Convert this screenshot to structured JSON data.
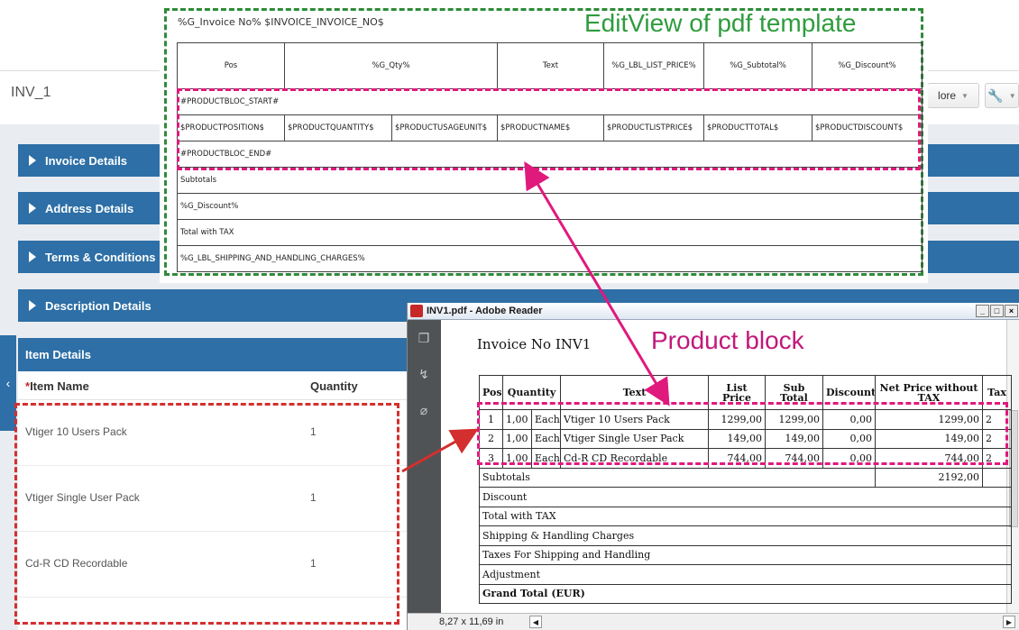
{
  "crm": {
    "record_title": "INV_1",
    "more_label": "lore",
    "blocks": [
      {
        "label": "Invoice Details"
      },
      {
        "label": "Address Details"
      },
      {
        "label": "Terms & Conditions"
      },
      {
        "label": "Description Details"
      }
    ],
    "item_details": {
      "title": "Item Details",
      "required_mark": "*",
      "col_name": "Item Name",
      "col_qty": "Quantity",
      "rows": [
        {
          "name": "Vtiger 10 Users Pack",
          "qty": "1"
        },
        {
          "name": "Vtiger Single User Pack",
          "qty": "1"
        },
        {
          "name": "Cd-R CD Recordable",
          "qty": "1"
        }
      ]
    }
  },
  "edit_view": {
    "header": "%G_Invoice No% $INVOICE_INVOICE_NO$",
    "title": "EditView of pdf template",
    "columns": [
      "Pos",
      "%G_Qty%",
      "Text",
      "%G_LBL_LIST_PRICE%",
      "%G_Subtotal%",
      "%G_Discount%"
    ],
    "block_start": "#PRODUCTBLOC_START#",
    "vars": [
      "$PRODUCTPOSITION$",
      "$PRODUCTQUANTITY$",
      "$PRODUCTUSAGEUNIT$",
      "$PRODUCTNAME$",
      "$PRODUCTLISTPRICE$",
      "$PRODUCTTOTAL$",
      "$PRODUCTDISCOUNT$"
    ],
    "block_end": "#PRODUCTBLOC_END#",
    "totals": [
      "Subtotals",
      "%G_Discount%",
      "Total with TAX",
      "%G_LBL_SHIPPING_AND_HANDLING_CHARGES%"
    ]
  },
  "reader": {
    "title": "INV1.pdf - Adobe Reader",
    "heading": "Invoice No INV1",
    "product_block_label": "Product block",
    "columns": [
      "Pos",
      "Quantity",
      "Text",
      "List Price",
      "Sub Total",
      "Discount",
      "Net Price without TAX",
      "Tax"
    ],
    "rows": [
      {
        "pos": "1",
        "qty": "1,00",
        "unit": "Each",
        "text": "Vtiger 10 Users Pack",
        "list": "1299,00",
        "sub": "1299,00",
        "disc": "0,00",
        "net": "1299,00",
        "tax": "2"
      },
      {
        "pos": "2",
        "qty": "1,00",
        "unit": "Each",
        "text": "Vtiger Single User Pack",
        "list": "149,00",
        "sub": "149,00",
        "disc": "0,00",
        "net": "149,00",
        "tax": "2"
      },
      {
        "pos": "3",
        "qty": "1,00",
        "unit": "Each",
        "text": "Cd-R CD Recordable",
        "list": "744,00",
        "sub": "744,00",
        "disc": "0,00",
        "net": "744,00",
        "tax": "2"
      }
    ],
    "subtotals_label": "Subtotals",
    "subtotals_value": "2192,00",
    "summary": [
      "Discount",
      "Total with TAX",
      "Shipping & Handling Charges",
      "Taxes For Shipping and Handling",
      "Adjustment"
    ],
    "grand_total": "Grand Total (EUR)",
    "page_size": "8,27 x 11,69 in"
  },
  "colors": {
    "accent_blue": "#2d6fa6",
    "green_dash": "#2e8b3a",
    "magenta": "#e0197d",
    "red_dash": "#d32f2f"
  }
}
